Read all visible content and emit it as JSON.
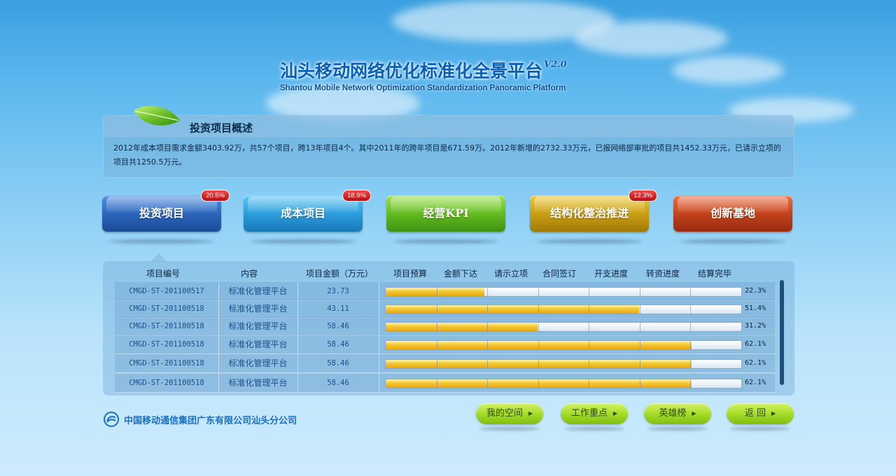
{
  "header": {
    "title_cn": "汕头移动网络优化标准化全景平台",
    "version": "V2.0",
    "title_en": "Shantou Mobile Network Optimization Standardization Panoramic Platform"
  },
  "overview": {
    "title": "投资项目概述",
    "text": "2012年成本项目需求金额3403.92万，共57个项目，跨13年项目4个。其中2011年的跨年项目是671.59万。2012年新增的2732.33万元，已报网络部审批的项目共1452.33万元，已请示立项的项目共1250.5万元。"
  },
  "categories": [
    {
      "label": "投资项目",
      "badge": "20.5%",
      "color": "#2a63b8"
    },
    {
      "label": "成本项目",
      "badge": "18.9%",
      "color": "#2a9ad8"
    },
    {
      "label": "经营KPI",
      "badge": "",
      "color": "#5fb81f"
    },
    {
      "label": "结构化整治推进",
      "badge": "12.3%",
      "color": "#c79b12"
    },
    {
      "label": "创新基地",
      "badge": "",
      "color": "#c0401c"
    }
  ],
  "table": {
    "headers": [
      "项目编号",
      "内容",
      "项目金额（万元）",
      "项目预算",
      "金额下达",
      "请示立项",
      "合同签订",
      "开支进度",
      "转资进度",
      "结算完毕"
    ],
    "rows": [
      {
        "code": "CMGD-ST-201100517",
        "content": "标准化管理平台",
        "amount": "23.73",
        "progress": 0.277,
        "pct": "22.3%"
      },
      {
        "code": "CMGD-ST-201100518",
        "content": "标准化管理平台",
        "amount": "43.11",
        "progress": 0.713,
        "pct": "51.4%"
      },
      {
        "code": "CMGD-ST-201100518",
        "content": "标准化管理平台",
        "amount": "58.46",
        "progress": 0.427,
        "pct": "31.2%"
      },
      {
        "code": "CMGD-ST-201100518",
        "content": "标准化管理平台",
        "amount": "58.46",
        "progress": 0.861,
        "pct": "62.1%"
      },
      {
        "code": "CMGD-ST-201100518",
        "content": "标准化管理平台",
        "amount": "58.46",
        "progress": 0.861,
        "pct": "62.1%"
      },
      {
        "code": "CMGD-ST-201100518",
        "content": "标准化管理平台",
        "amount": "58.46",
        "progress": 0.861,
        "pct": "62.1%"
      }
    ]
  },
  "footer": {
    "company": "中国移动通信集团广东有限公司汕头分公司",
    "nav": [
      "我的空间",
      "工作重点",
      "英雄榜",
      "返 回"
    ]
  }
}
